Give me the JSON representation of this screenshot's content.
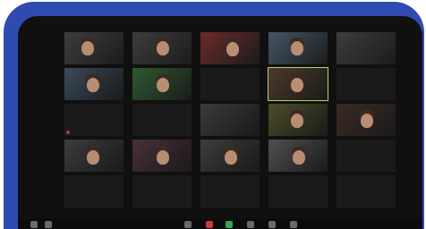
{
  "participants": [
    {
      "name": "",
      "type": "video"
    },
    {
      "name": "",
      "type": "video"
    },
    {
      "name": "",
      "type": "video"
    },
    {
      "name": "",
      "type": "video"
    },
    {
      "name": "",
      "type": "video"
    },
    {
      "name": "",
      "type": "video"
    },
    {
      "name": "",
      "type": "video"
    },
    {
      "name": "",
      "type": "video"
    },
    {
      "name": "",
      "type": "video"
    },
    {
      "name": "",
      "type": "video"
    },
    {
      "name": "",
      "type": "video"
    },
    {
      "name": "",
      "type": "video"
    },
    {
      "name": "",
      "type": "video"
    },
    {
      "name": "",
      "type": "video"
    },
    {
      "name": "",
      "type": "video"
    },
    {
      "name": "",
      "type": "video"
    },
    {
      "name": "",
      "type": "video"
    },
    {
      "name": "",
      "type": "video"
    },
    {
      "name": "",
      "type": "video"
    },
    {
      "name": "",
      "type": "video"
    },
    {
      "name": "",
      "type": "video"
    },
    {
      "name": "",
      "type": "video"
    },
    {
      "name": "",
      "type": "video"
    },
    {
      "name": "",
      "type": "video"
    },
    {
      "name": "",
      "type": "video"
    }
  ],
  "toolbar": {
    "buttons": [
      {
        "icon": "mute-icon"
      },
      {
        "icon": "video-icon"
      },
      {
        "icon": "participants-icon"
      },
      {
        "icon": "share-screen-icon"
      },
      {
        "icon": "chat-icon"
      },
      {
        "icon": "record-icon"
      },
      {
        "icon": "reactions-icon"
      },
      {
        "icon": "leave-icon"
      }
    ]
  },
  "colors": {
    "frame": "#2f4bb0",
    "screen": "#101010",
    "speaker_highlight": "#b7d35a",
    "muted": "#c82d2d"
  }
}
